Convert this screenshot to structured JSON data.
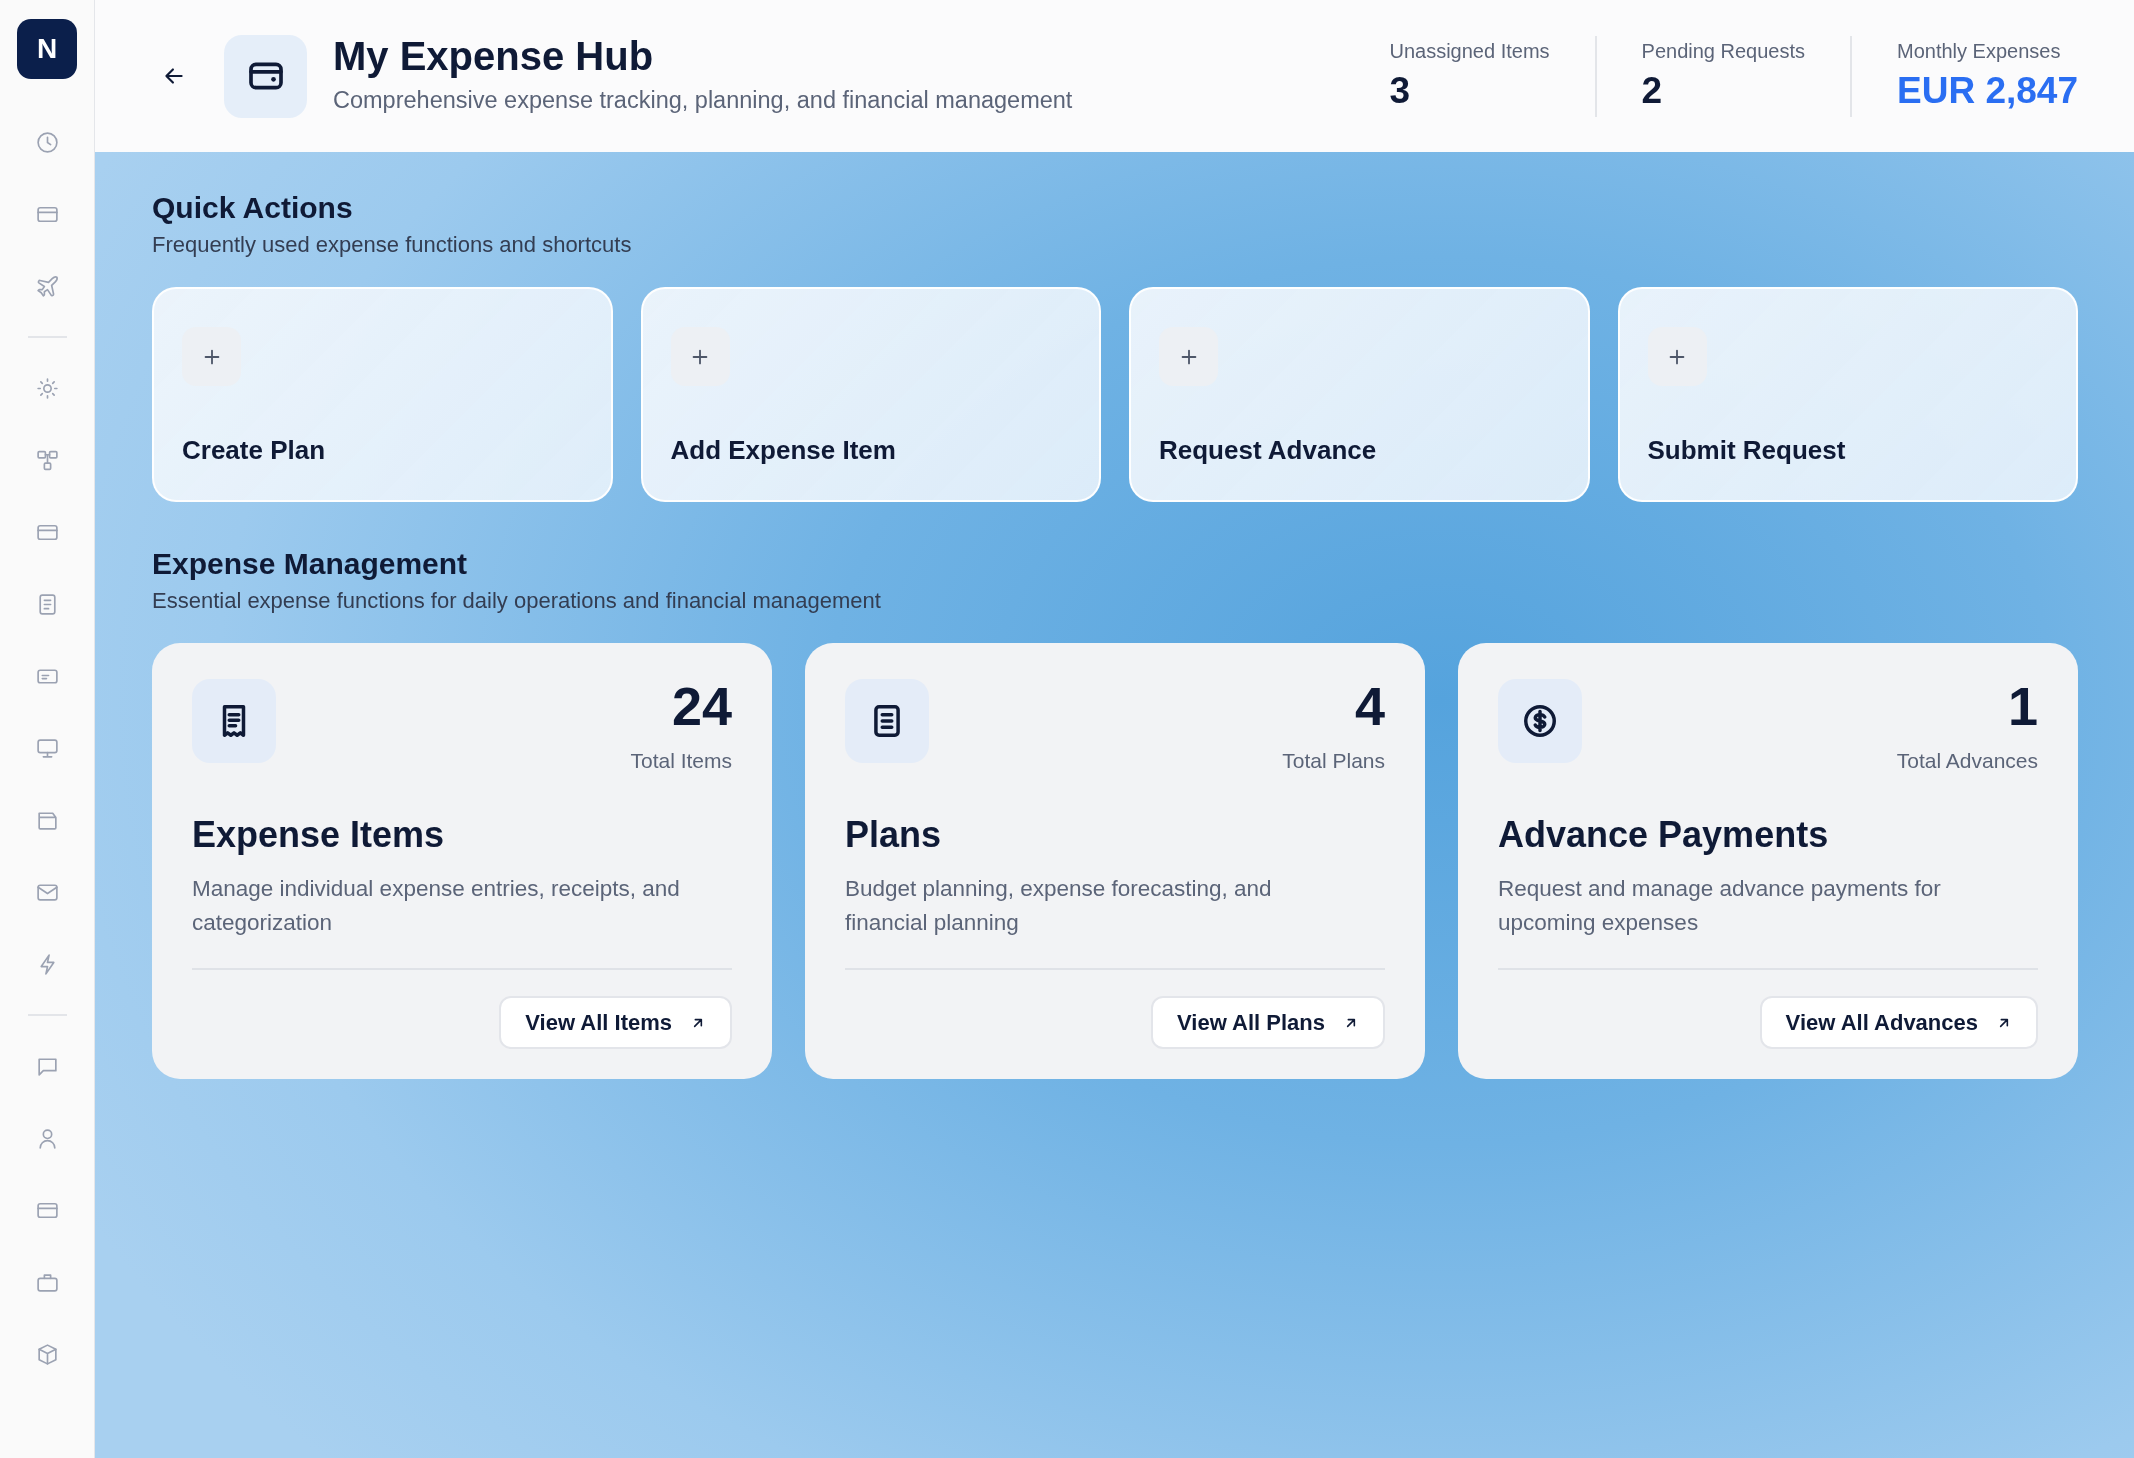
{
  "sidebar": {
    "logo": "N"
  },
  "header": {
    "title": "My Expense Hub",
    "subtitle": "Comprehensive expense tracking, planning, and financial management",
    "stats": [
      {
        "label": "Unassigned Items",
        "value": "3",
        "color": "#0f1a36"
      },
      {
        "label": "Pending Requests",
        "value": "2",
        "color": "#0f1a36"
      },
      {
        "label": "Monthly Expenses",
        "value": "EUR 2,847",
        "color": "#2a6ef2"
      }
    ]
  },
  "quick_actions": {
    "title": "Quick Actions",
    "subtitle": "Frequently used expense functions and shortcuts",
    "actions": [
      {
        "label": "Create Plan"
      },
      {
        "label": "Add Expense Item"
      },
      {
        "label": "Request Advance"
      },
      {
        "label": "Submit Request"
      }
    ]
  },
  "expense_management": {
    "title": "Expense Management",
    "subtitle": "Essential expense functions for daily operations and financial management",
    "cards": [
      {
        "count": "24",
        "count_label": "Total Items",
        "title": "Expense Items",
        "description": "Manage individual expense entries, receipts, and categorization",
        "button": "View All Items"
      },
      {
        "count": "4",
        "count_label": "Total Plans",
        "title": "Plans",
        "description": "Budget planning, expense forecasting, and financial planning",
        "button": "View All Plans"
      },
      {
        "count": "1",
        "count_label": "Total Advances",
        "title": "Advance Payments",
        "description": "Request and manage advance payments for upcoming expenses",
        "button": "View All Advances"
      }
    ]
  }
}
